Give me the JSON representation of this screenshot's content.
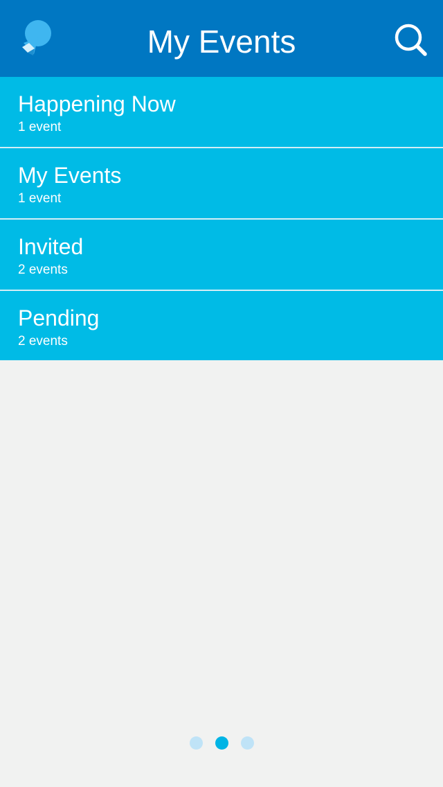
{
  "header": {
    "title": "My Events",
    "logo_icon": "app-logo-icon",
    "search_icon": "search-icon",
    "bg_color": "#0077c2"
  },
  "list": {
    "item_color": "#00bbe6",
    "items": [
      {
        "label": "Happening Now",
        "count": "1 event"
      },
      {
        "label": "My Events",
        "count": "1 event"
      },
      {
        "label": "Invited",
        "count": "2 events"
      },
      {
        "label": "Pending",
        "count": "2 events"
      }
    ]
  },
  "pager": {
    "pages": 3,
    "active_page": 2,
    "active_color": "#00b4e5",
    "inactive_color": "#bfe3f7"
  }
}
